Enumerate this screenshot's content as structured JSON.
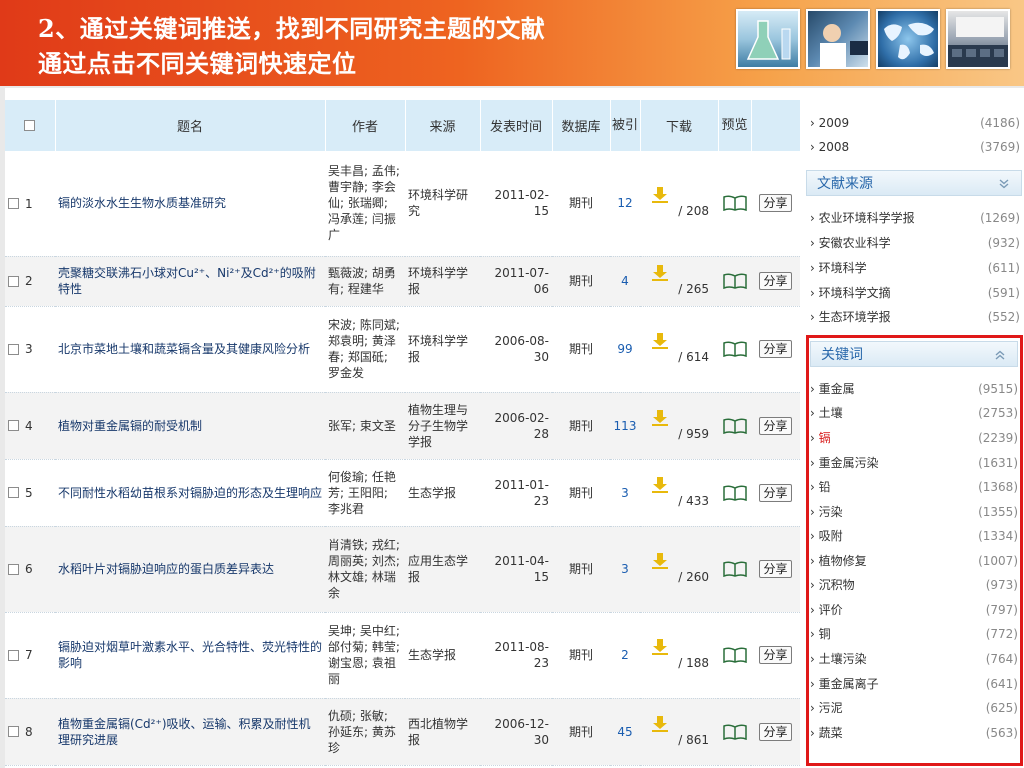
{
  "banner": {
    "title_line1": "2、通过关键词推送，找到不同研究主题的文献",
    "title_line2": "通过点击不同关键词快速定位"
  },
  "table": {
    "headers": {
      "title": "题名",
      "author": "作者",
      "source": "来源",
      "date": "发表时间",
      "db": "数据库",
      "cited": "被引",
      "download": "下载",
      "preview": "预览"
    },
    "rows": [
      {
        "idx": "1",
        "title": "镉的淡水水生生物水质基准研究",
        "author": "吴丰昌; 孟伟; 曹宇静; 李会仙; 张瑞卿; 冯承莲; 闫振广",
        "source": "环境科学研究",
        "date": "2011-02-15",
        "db": "期刊",
        "cited": "12",
        "downloads": "/ 208",
        "share": "分享"
      },
      {
        "idx": "2",
        "title": "壳聚糖交联沸石小球对Cu²⁺、Ni²⁺及Cd²⁺的吸附特性",
        "author": "甄薇波; 胡勇有; 程建华",
        "source": "环境科学学报",
        "date": "2011-07-06",
        "db": "期刊",
        "cited": "4",
        "downloads": "/ 265",
        "share": "分享"
      },
      {
        "idx": "3",
        "title": "北京市菜地土壤和蔬菜镉含量及其健康风险分析",
        "author": "宋波; 陈同斌; 郑袁明; 黄泽春; 郑国砥; 罗金发",
        "source": "环境科学学报",
        "date": "2006-08-30",
        "db": "期刊",
        "cited": "99",
        "downloads": "/ 614",
        "share": "分享"
      },
      {
        "idx": "4",
        "title": "植物对重金属镉的耐受机制",
        "author": "张军; 束文圣",
        "source": "植物生理与分子生物学学报",
        "date": "2006-02-28",
        "db": "期刊",
        "cited": "113",
        "downloads": "/ 959",
        "share": "分享"
      },
      {
        "idx": "5",
        "title": "不同耐性水稻幼苗根系对镉胁迫的形态及生理响应",
        "author": "何俊瑜; 任艳芳; 王阳阳; 李兆君",
        "source": "生态学报",
        "date": "2011-01-23",
        "db": "期刊",
        "cited": "3",
        "downloads": "/ 433",
        "share": "分享"
      },
      {
        "idx": "6",
        "title": "水稻叶片对镉胁迫响应的蛋白质差异表达",
        "author": "肖清铁; 戎红; 周丽英; 刘杰; 林文雄; 林瑞余",
        "source": "应用生态学报",
        "date": "2011-04-15",
        "db": "期刊",
        "cited": "3",
        "downloads": "/ 260",
        "share": "分享"
      },
      {
        "idx": "7",
        "title": "镉胁迫对烟草叶激素水平、光合特性、荧光特性的影响",
        "author": "吴坤; 吴中红; 邰付菊; 韩莹; 谢宝恩; 袁祖丽",
        "source": "生态学报",
        "date": "2011-08-23",
        "db": "期刊",
        "cited": "2",
        "downloads": "/ 188",
        "share": "分享"
      },
      {
        "idx": "8",
        "title": "植物重金属镉(Cd²⁺)吸收、运输、积累及耐性机理研究进展",
        "author": "仇硕; 张敏; 孙延东; 黄苏珍",
        "source": "西北植物学报",
        "date": "2006-12-30",
        "db": "期刊",
        "cited": "45",
        "downloads": "/ 861",
        "share": "分享"
      }
    ]
  },
  "sidebar": {
    "years": [
      {
        "label": "2009",
        "count": "(4186)"
      },
      {
        "label": "2008",
        "count": "(3769)"
      }
    ],
    "source_section": {
      "title": "文献来源",
      "items": [
        {
          "label": "农业环境科学学报",
          "count": "(1269)"
        },
        {
          "label": "安徽农业科学",
          "count": "(932)"
        },
        {
          "label": "环境科学",
          "count": "(611)"
        },
        {
          "label": "环境科学文摘",
          "count": "(591)"
        },
        {
          "label": "生态环境学报",
          "count": "(552)"
        }
      ]
    },
    "keyword_section": {
      "title": "关键词",
      "items": [
        {
          "label": "重金属",
          "count": "(9515)"
        },
        {
          "label": "土壤",
          "count": "(2753)"
        },
        {
          "label": "镉",
          "count": "(2239)"
        },
        {
          "label": "重金属污染",
          "count": "(1631)"
        },
        {
          "label": "铅",
          "count": "(1368)"
        },
        {
          "label": "污染",
          "count": "(1355)"
        },
        {
          "label": "吸附",
          "count": "(1334)"
        },
        {
          "label": "植物修复",
          "count": "(1007)"
        },
        {
          "label": "沉积物",
          "count": "(973)"
        },
        {
          "label": "评价",
          "count": "(797)"
        },
        {
          "label": "铜",
          "count": "(772)"
        },
        {
          "label": "土壤污染",
          "count": "(764)"
        },
        {
          "label": "重金属离子",
          "count": "(641)"
        },
        {
          "label": "污泥",
          "count": "(625)"
        },
        {
          "label": "蔬菜",
          "count": "(563)"
        }
      ]
    }
  },
  "colors": {
    "banner_start": "#e03a18",
    "banner_end": "#f9c786",
    "header_bg": "#d8ecf8",
    "link_blue": "#1a5db0",
    "highlight_red": "#e01818",
    "download_arrow": "#e8b90c"
  }
}
